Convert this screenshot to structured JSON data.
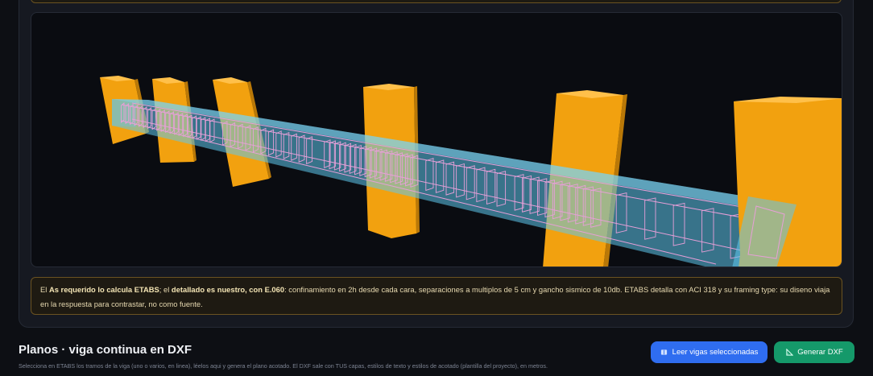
{
  "note": {
    "p1": "El ",
    "b1": "As requerido lo calcula ETABS",
    "p2": "; el ",
    "b2": "detallado es nuestro, con E.060",
    "p3": ": confinamiento en 2h desde cada cara, separaciones a multiplos de 5 cm y gancho sismico de 10db. ETABS detalla con ACI 318 y su framing type: su diseno viaja en la respuesta para contrastar, no como fuente."
  },
  "footer": {
    "title": "Planos · viga continua en DXF",
    "subtitle": "Selecciona en ETABS los tramos de la viga (uno o varios, en linea), léelos aqui y genera el plano acotado. El DXF sale con TUS capas, estilos de texto y estilos de acotado (plantilla del proyecto), en metros."
  },
  "buttons": {
    "read_label": "Leer vigas seleccionadas",
    "read_icon": "book-icon",
    "dxf_label": "Generar DXF",
    "dxf_icon": "triangle-ruler-icon"
  },
  "colors": {
    "column": "#f2a10f",
    "beam": "#5ec8ee",
    "rebar": "#e79fd8",
    "primary": "#2f6df0",
    "success": "#15996a",
    "note_border": "#6b5321"
  }
}
